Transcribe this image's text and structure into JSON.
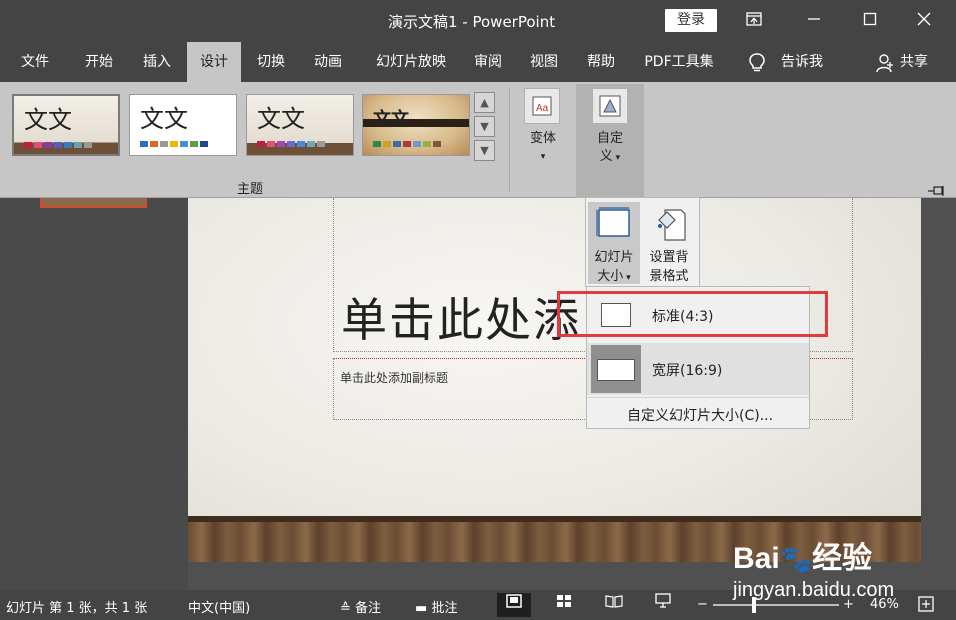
{
  "window": {
    "title": "演示文稿1  -  PowerPoint",
    "login_label": "登录"
  },
  "tabs": [
    {
      "label": "文件"
    },
    {
      "label": "开始"
    },
    {
      "label": "插入"
    },
    {
      "label": "设计"
    },
    {
      "label": "切换"
    },
    {
      "label": "动画"
    },
    {
      "label": "幻灯片放映"
    },
    {
      "label": "审阅"
    },
    {
      "label": "视图"
    },
    {
      "label": "帮助"
    },
    {
      "label": "PDF工具集"
    },
    {
      "label": "告诉我"
    },
    {
      "label": "共享"
    }
  ],
  "active_tab": "设计",
  "ribbon": {
    "themes": [
      {
        "sample": "文文",
        "colors": [
          "#c0203c",
          "#e0507a",
          "#8a3aa0",
          "#5a5ac0",
          "#3a7ac0",
          "#6aa0b0",
          "#9a9a9a"
        ]
      },
      {
        "sample": "文文",
        "colors": [
          "#2f6bc4",
          "#e06a1c",
          "#9a9a9a",
          "#f2b400",
          "#4a90d0",
          "#5aa040",
          "#1c4a8a"
        ]
      },
      {
        "sample": "文文",
        "colors": [
          "#c0203c",
          "#e0507a",
          "#a04ab0",
          "#6a6ad0",
          "#4a8ad0",
          "#70a8b8",
          "#9a9a9a"
        ]
      },
      {
        "sample": "文文",
        "colors": [
          "#2a8a4a",
          "#d0a020",
          "#3a6ab0",
          "#b03a3a",
          "#6a9ad0",
          "#9ab040",
          "#7a5a3a"
        ]
      }
    ],
    "themes_group_label": "主题",
    "variants_label": "变体",
    "customize_label_1": "自定",
    "customize_label_2": "义"
  },
  "slide": {
    "title_placeholder": "单击此处添",
    "subtitle_placeholder": "单击此处添加副标题"
  },
  "customize_dropdown": {
    "slide_size_label_1": "幻灯片",
    "slide_size_label_2": "大小",
    "format_bg_label_1": "设置背",
    "format_bg_label_2": "景格式"
  },
  "slide_size_menu": {
    "standard": "标准(4:3)",
    "widescreen": "宽屏(16:9)",
    "custom": "自定义幻灯片大小(C)..."
  },
  "status": {
    "slide_info": "幻灯片 第 1 张，共 1 张",
    "language": "中文(中国)",
    "notes_label": "备注",
    "comments_label": "批注",
    "zoom_minus": "−",
    "zoom_plus": "+",
    "zoom_percent": "46%",
    "zoom_level": 0.46
  },
  "watermark": {
    "brand": "Bai",
    "brand_suffix": "经验",
    "url": "jingyan.baidu.com"
  }
}
